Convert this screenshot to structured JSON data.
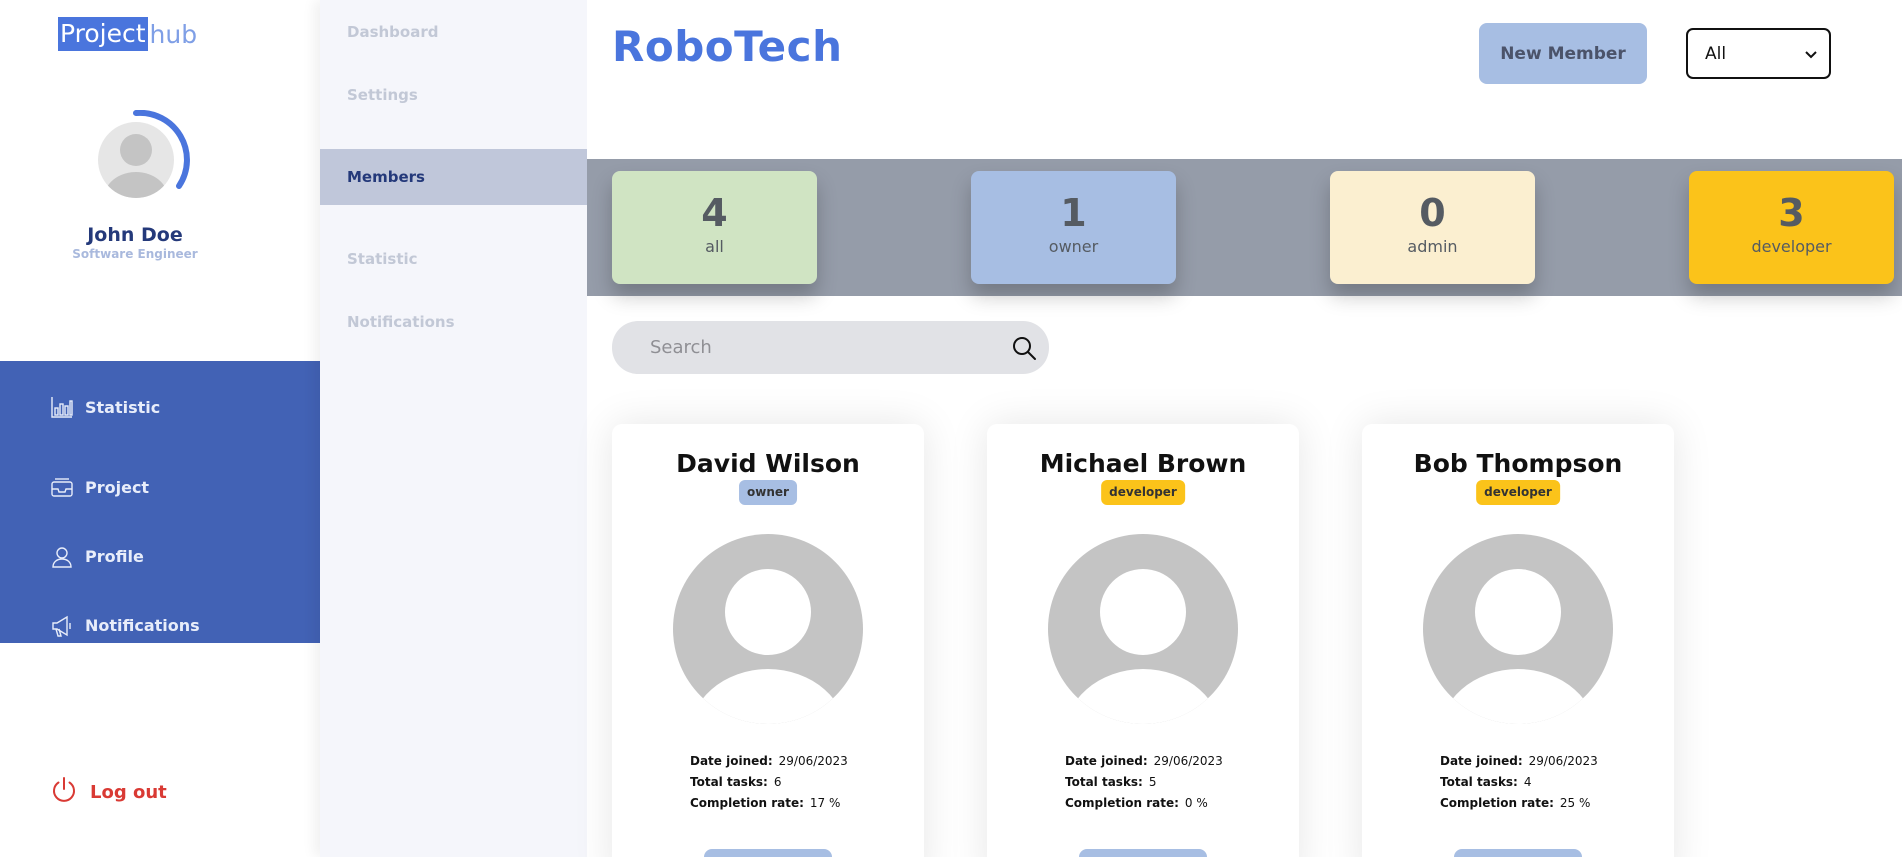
{
  "logo": {
    "part1": "Project",
    "part2": "hub"
  },
  "user": {
    "name": "John Doe",
    "role": "Software Engineer"
  },
  "main_nav": [
    {
      "label": "Statistic",
      "icon": "bar-chart-icon"
    },
    {
      "label": "Project",
      "icon": "inbox-icon"
    },
    {
      "label": "Profile",
      "icon": "user-icon"
    },
    {
      "label": "Notifications",
      "icon": "megaphone-icon"
    }
  ],
  "logout": {
    "label": "Log out",
    "icon": "power-icon"
  },
  "sub_nav": [
    {
      "label": "Dashboard"
    },
    {
      "label": "Settings"
    },
    {
      "label": "Members",
      "active": true
    },
    {
      "label": "Statistic"
    },
    {
      "label": "Notifications"
    }
  ],
  "header": {
    "title": "RoboTech",
    "new_member_label": "New Member",
    "filter_selected": "All"
  },
  "stats": [
    {
      "value": "4",
      "label": "all",
      "color": "#d0e4c3"
    },
    {
      "value": "1",
      "label": "owner",
      "color": "#a7bee3"
    },
    {
      "value": "0",
      "label": "admin",
      "color": "#fbefd0"
    },
    {
      "value": "3",
      "label": "developer",
      "color": "#fbc31a"
    }
  ],
  "search": {
    "placeholder": "Search"
  },
  "members": [
    {
      "name": "David Wilson",
      "role": "owner",
      "role_color": "#a7bee3",
      "date_joined_label": "Date joined:",
      "date_joined": "29/06/2023",
      "total_tasks_label": "Total tasks:",
      "total_tasks": "6",
      "completion_label": "Completion rate:",
      "completion_rate": "17 %"
    },
    {
      "name": "Michael Brown",
      "role": "developer",
      "role_color": "#fbc31a",
      "date_joined_label": "Date joined:",
      "date_joined": "29/06/2023",
      "total_tasks_label": "Total tasks:",
      "total_tasks": "5",
      "completion_label": "Completion rate:",
      "completion_rate": "0 %"
    },
    {
      "name": "Bob Thompson",
      "role": "developer",
      "role_color": "#fbc31a",
      "date_joined_label": "Date joined:",
      "date_joined": "29/06/2023",
      "total_tasks_label": "Total tasks:",
      "total_tasks": "4",
      "completion_label": "Completion rate:",
      "completion_rate": "25 %"
    }
  ]
}
